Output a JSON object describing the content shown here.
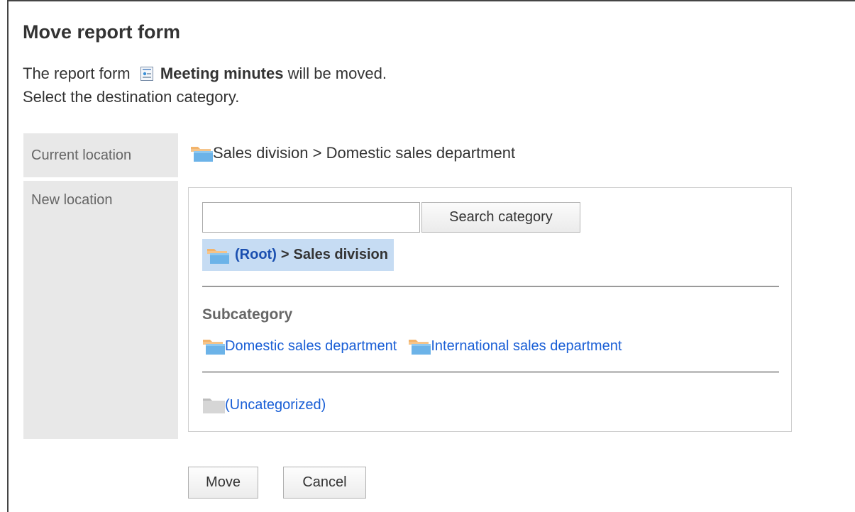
{
  "page": {
    "title": "Move report form"
  },
  "description": {
    "line1_prefix": "The report form",
    "form_name": "Meeting minutes",
    "line1_suffix": "will be moved.",
    "line2": "Select the destination category."
  },
  "current_location": {
    "label": "Current location",
    "value": "Sales division > Domestic sales department"
  },
  "new_location": {
    "label": "New location",
    "search_input_value": "",
    "search_button_label": "Search category",
    "breadcrumb": {
      "root": "(Root)",
      "separator": ">",
      "current": "Sales division"
    },
    "subcategory_heading": "Subcategory",
    "subcategories": [
      {
        "label": "Domestic sales department",
        "icon": "folder-icon"
      },
      {
        "label": "International sales department",
        "icon": "folder-icon"
      }
    ],
    "uncategorized": {
      "label": "(Uncategorized)",
      "icon": "gray-folder-icon"
    }
  },
  "actions": {
    "move_label": "Move",
    "cancel_label": "Cancel"
  },
  "colors": {
    "link": "#1a5fd6",
    "breadcrumb_bg": "#c6dcf3",
    "label_bg": "#e8e8e8",
    "folder_back": "#f3b46b",
    "folder_front": "#6cb3e8"
  }
}
